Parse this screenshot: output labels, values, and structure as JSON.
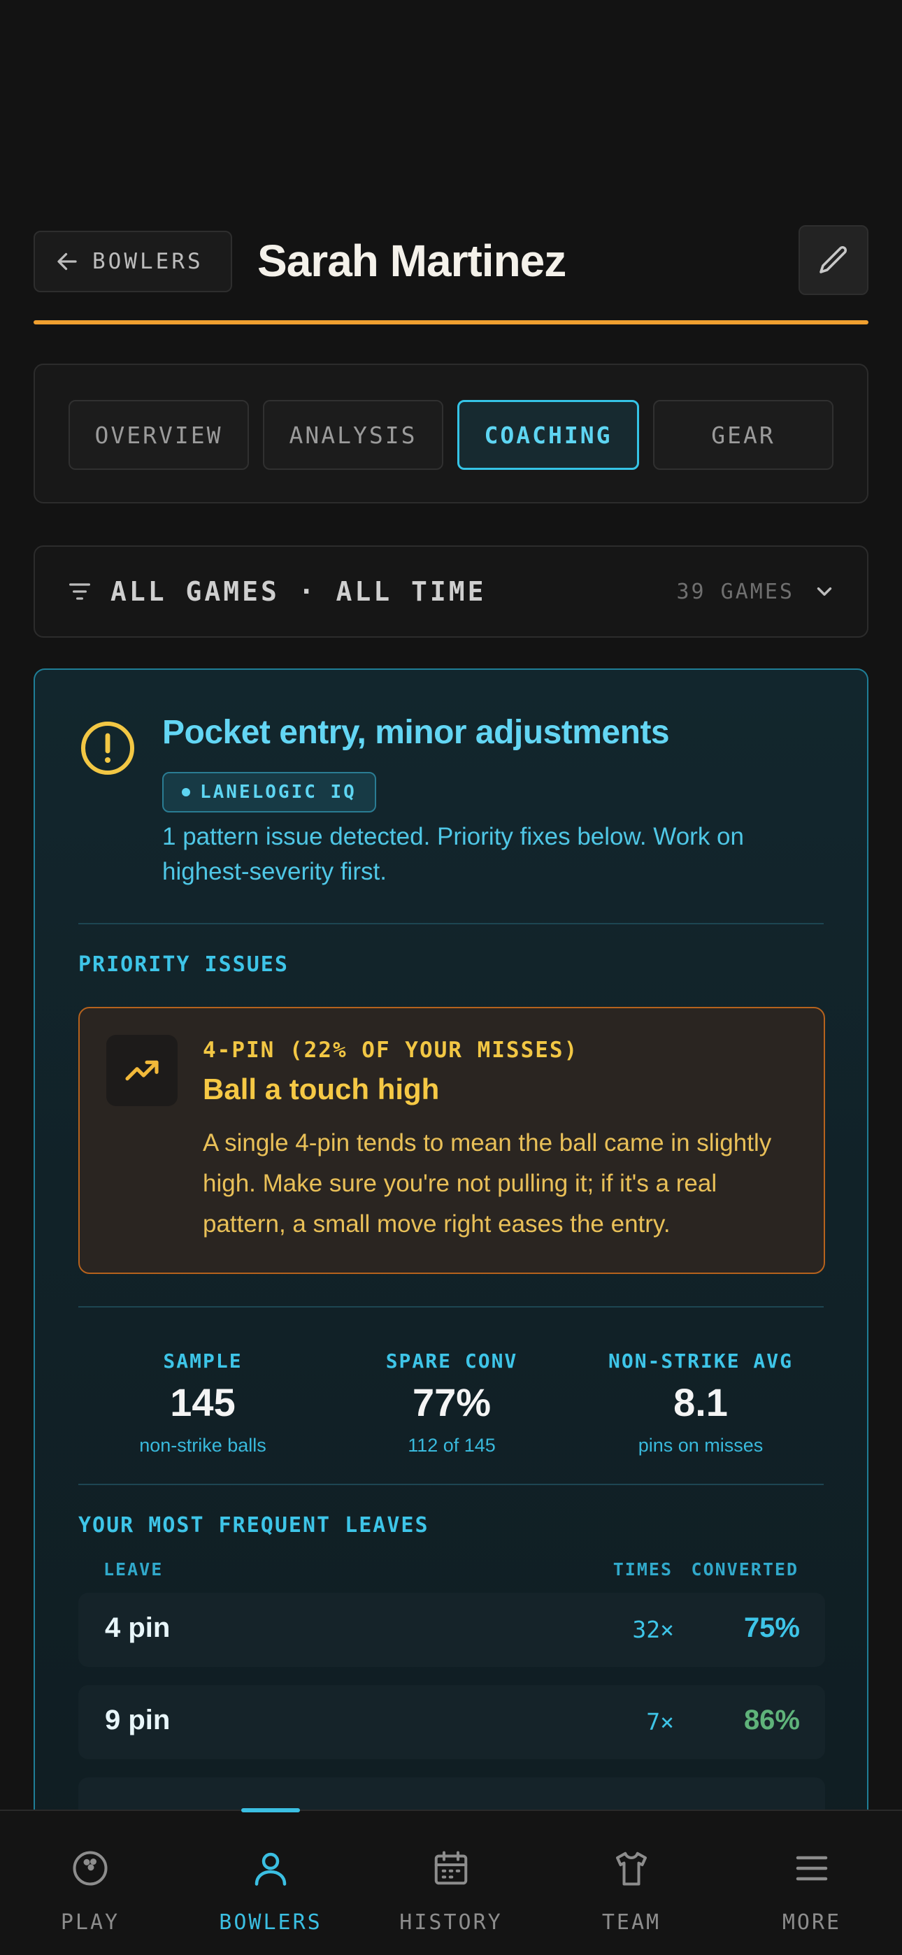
{
  "header": {
    "back_label": "BOWLERS",
    "title": "Sarah Martinez",
    "accent_color": "#f0a030"
  },
  "tabs": [
    {
      "label": "OVERVIEW",
      "active": false
    },
    {
      "label": "ANALYSIS",
      "active": false
    },
    {
      "label": "COACHING",
      "active": true
    },
    {
      "label": "GEAR",
      "active": false
    }
  ],
  "filter": {
    "label": "ALL GAMES · ALL TIME",
    "count": "39 GAMES"
  },
  "coaching": {
    "title": "Pocket entry, minor adjustments",
    "badge": "LANELOGIC IQ",
    "summary": "1 pattern issue detected. Priority fixes below. Work on highest-severity first.",
    "priority_label": "PRIORITY ISSUES",
    "issue": {
      "kicker": "4-PIN (22% OF YOUR MISSES)",
      "title": "Ball a touch high",
      "body": "A single 4-pin tends to mean the ball came in slightly high. Make sure you're not pulling it; if it's a real pattern, a small move right eases the entry.",
      "icon": "trend-up-icon"
    },
    "stats": [
      {
        "label": "SAMPLE",
        "value": "145",
        "sub": "non-strike balls"
      },
      {
        "label": "SPARE CONV",
        "value": "77%",
        "sub": "112 of 145"
      },
      {
        "label": "NON-STRIKE AVG",
        "value": "8.1",
        "sub": "pins on misses"
      }
    ],
    "leaves_label": "YOUR MOST FREQUENT LEAVES",
    "leaves_columns": {
      "leave": "LEAVE",
      "times": "TIMES",
      "converted": "CONVERTED"
    },
    "leaves": [
      {
        "name": "4 pin",
        "times": "32×",
        "converted": "75%",
        "color": "#3ec5e8"
      },
      {
        "name": "9 pin",
        "times": "7×",
        "converted": "86%",
        "color": "#5fb37a"
      }
    ]
  },
  "nav": [
    {
      "label": "PLAY",
      "icon": "bowling-ball-icon",
      "active": false
    },
    {
      "label": "BOWLERS",
      "icon": "person-icon",
      "active": true
    },
    {
      "label": "HISTORY",
      "icon": "calendar-icon",
      "active": false
    },
    {
      "label": "TEAM",
      "icon": "shirt-icon",
      "active": false
    },
    {
      "label": "MORE",
      "icon": "menu-icon",
      "active": false
    }
  ]
}
